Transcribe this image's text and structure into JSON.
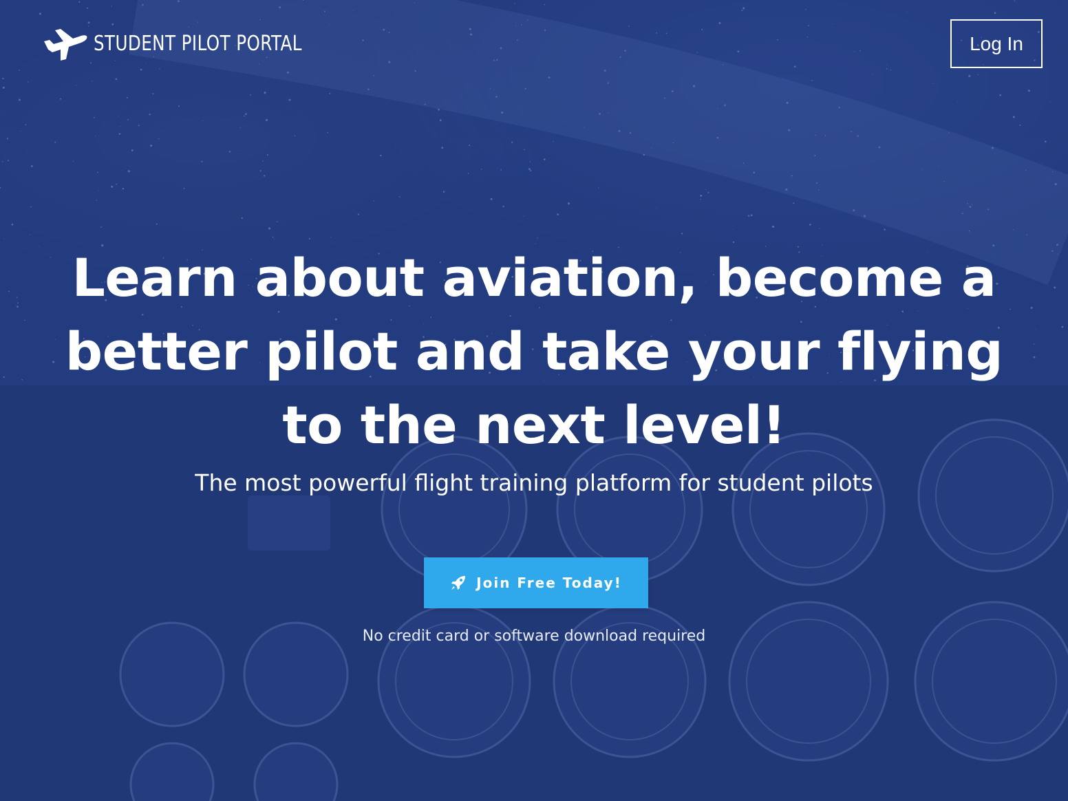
{
  "nav": {
    "brand_icon": "airplane-icon",
    "brand_name": "STUDENT PILOT PORTAL",
    "login_label": "Log In"
  },
  "hero": {
    "headline": "Learn about aviation, become a better pilot and take your flying to the next level!",
    "subheadline": "The most powerful flight training platform for student pilots",
    "cta_icon": "rocket-icon",
    "cta_label": "Join Free Today!",
    "note": "No credit card or software download required"
  },
  "colors": {
    "background_overlay": "#223a7d",
    "cta": "#2fa8ec",
    "text": "#ffffff"
  }
}
